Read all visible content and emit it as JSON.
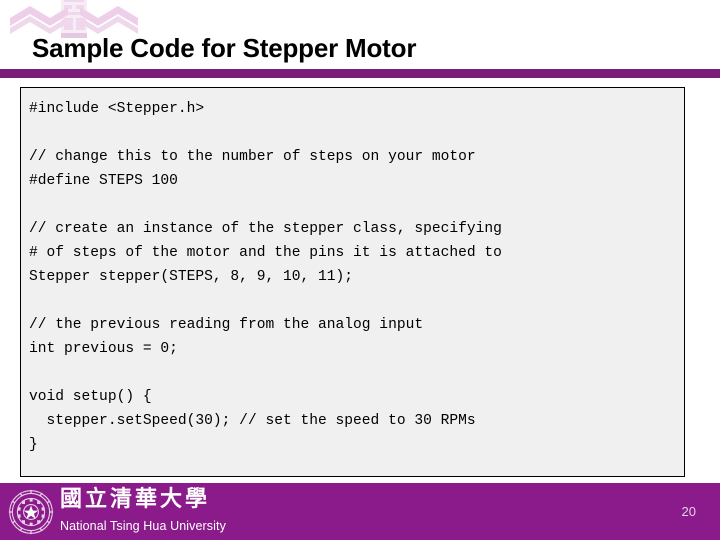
{
  "slide": {
    "title": "Sample Code for Stepper Motor",
    "page_number": "20",
    "accent_color": "#7b1d7b",
    "footer_color": "#8b1a8b",
    "code_background": "#f0f0f0",
    "logo_watermark_color": "#edcfe9"
  },
  "header": {
    "logo_icon": "nthu-chevron-logo",
    "title": "Sample Code for Stepper Motor"
  },
  "code": {
    "language": "arduino-c",
    "lines": [
      "#include <Stepper.h>",
      "",
      "// change this to the number of steps on your motor",
      "#define STEPS 100",
      "",
      "// create an instance of the stepper class, specifying",
      "# of steps of the motor and the pins it is attached to",
      "Stepper stepper(STEPS, 8, 9, 10, 11);",
      "",
      "// the previous reading from the analog input",
      "int previous = 0;",
      "",
      "void setup() {",
      "  stepper.setSpeed(30); // set the speed to 30 RPMs",
      "}"
    ],
    "text": "#include <Stepper.h>\n\n// change this to the number of steps on your motor\n#define STEPS 100\n\n// create an instance of the stepper class, specifying\n# of steps of the motor and the pins it is attached to\nStepper stepper(STEPS, 8, 9, 10, 11);\n\n// the previous reading from the analog input\nint previous = 0;\n\nvoid setup() {\n  stepper.setSpeed(30); // set the speed to 30 RPMs\n}"
  },
  "footer": {
    "seal_icon": "nthu-seal-icon",
    "university_cn": "國立清華大學",
    "university_en": "National Tsing Hua University",
    "page_number": "20"
  }
}
